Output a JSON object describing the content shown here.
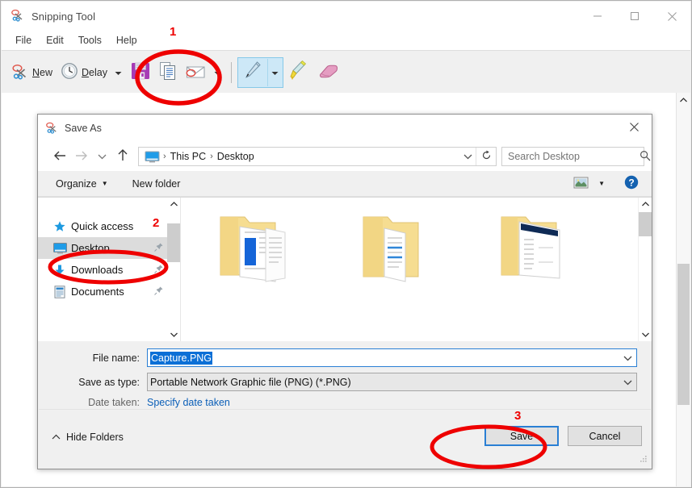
{
  "app": {
    "title": "Snipping Tool",
    "title_icon": "scissors-icon"
  },
  "window_controls": {
    "minimize": "minimize-icon",
    "maximize": "maximize-icon",
    "close": "close-icon"
  },
  "menu": {
    "items": [
      "File",
      "Edit",
      "Tools",
      "Help"
    ]
  },
  "toolbar": {
    "new_label": "New",
    "new_accesskey": "N",
    "delay_label": "Delay",
    "delay_accesskey": "D",
    "icons": {
      "new": "scissors-icon",
      "delay": "clock-icon",
      "delay_dropdown": "chevron-down-icon",
      "save": "floppy-disk-save-icon",
      "copy": "copy-pages-icon",
      "email": "envelope-email-icon",
      "email_dropdown": "chevron-down-icon",
      "pen": "pen-icon",
      "pen_dropdown": "chevron-down-icon",
      "highlighter": "highlighter-icon",
      "eraser": "eraser-icon"
    }
  },
  "dialog": {
    "title": "Save As",
    "title_icon": "scissors-icon",
    "close_icon": "close-icon",
    "nav": {
      "back_icon": "arrow-left-icon",
      "forward_icon": "arrow-right-icon",
      "recent_icon": "chevron-down-icon",
      "up_icon": "arrow-up-icon"
    },
    "address": {
      "computer_icon": "this-pc-monitor-icon",
      "crumbs": [
        "This PC",
        "Desktop"
      ],
      "separator": "›",
      "dropdown_icon": "chevron-down-icon",
      "refresh_icon": "refresh-icon"
    },
    "search": {
      "placeholder": "Search Desktop",
      "value": "",
      "icon": "search-icon"
    },
    "commandbar": {
      "organize_label": "Organize",
      "organize_caret": "▼",
      "new_folder_label": "New folder",
      "view_icon": "view-layout-icon",
      "view_caret": "▼",
      "help_icon": "help-question-icon"
    },
    "navpane": {
      "items": [
        {
          "label": "Quick access",
          "icon": "star-icon",
          "selected": false,
          "pinned": false
        },
        {
          "label": "Desktop",
          "icon": "desktop-monitor-icon",
          "selected": true,
          "pinned": true
        },
        {
          "label": "Downloads",
          "icon": "download-arrow-icon",
          "selected": false,
          "pinned": true
        },
        {
          "label": "Documents",
          "icon": "documents-icon",
          "selected": false,
          "pinned": true
        }
      ],
      "scroll_up_icon": "chevron-up-icon",
      "scroll_down_icon": "chevron-down-icon"
    },
    "filelist": {
      "items": [
        {
          "name": "",
          "icon": "folder-with-document-icon"
        },
        {
          "name": "",
          "icon": "folder-with-document-icon"
        },
        {
          "name": "",
          "icon": "folder-with-document-icon"
        }
      ],
      "scroll_up_icon": "chevron-up-icon",
      "scroll_down_icon": "chevron-down-icon"
    },
    "form": {
      "filename_label": "File name:",
      "filename_value": "Capture.PNG",
      "filename_caret": "chevron-down-icon",
      "filetype_label": "Save as type:",
      "filetype_value": "Portable Network Graphic file (PNG) (*.PNG)",
      "filetype_caret": "chevron-down-icon",
      "datetaken_label": "Date taken:",
      "datetaken_link": "Specify date taken"
    },
    "footer": {
      "hide_folders_label": "Hide Folders",
      "hide_folders_icon": "chevron-up-icon",
      "save_label": "Save",
      "cancel_label": "Cancel",
      "resize_grip_icon": "resize-grip-icon"
    }
  },
  "annotations": {
    "color": "#ee0000",
    "markers": [
      {
        "number": "1",
        "target": "save-toolbar-button"
      },
      {
        "number": "2",
        "target": "nav-item-desktop"
      },
      {
        "number": "3",
        "target": "save-dialog-button"
      }
    ]
  }
}
